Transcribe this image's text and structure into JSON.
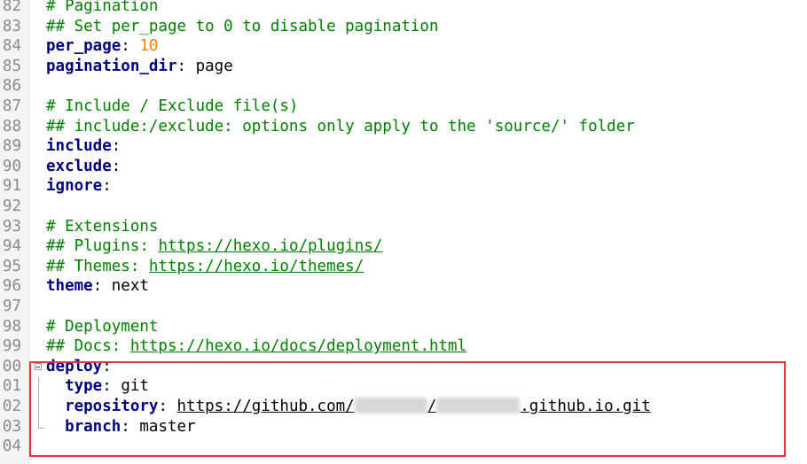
{
  "editor": {
    "lines": [
      {
        "num": "82",
        "parts": [
          {
            "t": "comment",
            "v": "# Pagination"
          }
        ]
      },
      {
        "num": "83",
        "parts": [
          {
            "t": "comment",
            "v": "## Set per_page to 0 to disable pagination"
          }
        ]
      },
      {
        "num": "84",
        "parts": [
          {
            "t": "key",
            "v": "per_page"
          },
          {
            "t": "sep",
            "v": ": "
          },
          {
            "t": "num",
            "v": "10"
          }
        ]
      },
      {
        "num": "85",
        "parts": [
          {
            "t": "key",
            "v": "pagination_dir"
          },
          {
            "t": "sep",
            "v": ": "
          },
          {
            "t": "val",
            "v": "page"
          }
        ]
      },
      {
        "num": "86",
        "parts": []
      },
      {
        "num": "87",
        "parts": [
          {
            "t": "comment",
            "v": "# Include / Exclude file(s)"
          }
        ]
      },
      {
        "num": "88",
        "parts": [
          {
            "t": "comment",
            "v": "## include:/exclude: options only apply to the 'source/' folder"
          }
        ]
      },
      {
        "num": "89",
        "parts": [
          {
            "t": "key",
            "v": "include"
          },
          {
            "t": "sep",
            "v": ":"
          }
        ]
      },
      {
        "num": "90",
        "parts": [
          {
            "t": "key",
            "v": "exclude"
          },
          {
            "t": "sep",
            "v": ":"
          }
        ]
      },
      {
        "num": "91",
        "parts": [
          {
            "t": "key",
            "v": "ignore"
          },
          {
            "t": "sep",
            "v": ":"
          }
        ]
      },
      {
        "num": "92",
        "parts": []
      },
      {
        "num": "93",
        "parts": [
          {
            "t": "comment",
            "v": "# Extensions"
          }
        ]
      },
      {
        "num": "94",
        "parts": [
          {
            "t": "comment",
            "v": "## Plugins: "
          },
          {
            "t": "link",
            "v": "https://hexo.io/plugins/"
          }
        ]
      },
      {
        "num": "95",
        "parts": [
          {
            "t": "comment",
            "v": "## Themes: "
          },
          {
            "t": "link",
            "v": "https://hexo.io/themes/"
          }
        ]
      },
      {
        "num": "96",
        "parts": [
          {
            "t": "key",
            "v": "theme"
          },
          {
            "t": "sep",
            "v": ": "
          },
          {
            "t": "val",
            "v": "next"
          }
        ]
      },
      {
        "num": "97",
        "parts": []
      },
      {
        "num": "98",
        "parts": [
          {
            "t": "comment",
            "v": "# Deployment"
          }
        ]
      },
      {
        "num": "99",
        "parts": [
          {
            "t": "comment",
            "v": "## Docs: "
          },
          {
            "t": "link",
            "v": "https://hexo.io/docs/deployment.html"
          }
        ]
      },
      {
        "num": "00",
        "fold": "open",
        "parts": [
          {
            "t": "key",
            "v": "deploy"
          },
          {
            "t": "sep",
            "v": ":"
          }
        ]
      },
      {
        "num": "01",
        "fold": "line",
        "parts": [
          {
            "t": "val",
            "v": "  "
          },
          {
            "t": "key",
            "v": "type"
          },
          {
            "t": "sep",
            "v": ": "
          },
          {
            "t": "val",
            "v": "git"
          }
        ]
      },
      {
        "num": "02",
        "fold": "line",
        "parts": [
          {
            "t": "val",
            "v": "  "
          },
          {
            "t": "key",
            "v": "repository"
          },
          {
            "t": "sep",
            "v": ": "
          },
          {
            "t": "url",
            "v": "https://github.com/"
          },
          {
            "t": "blur",
            "w": 82
          },
          {
            "t": "url",
            "v": "/"
          },
          {
            "t": "blur",
            "w": 94
          },
          {
            "t": "url",
            "v": ".github.io.git"
          }
        ]
      },
      {
        "num": "03",
        "fold": "end",
        "parts": [
          {
            "t": "val",
            "v": "  "
          },
          {
            "t": "key",
            "v": "branch"
          },
          {
            "t": "sep",
            "v": ": "
          },
          {
            "t": "val",
            "v": "master"
          }
        ]
      },
      {
        "num": "04",
        "parts": []
      }
    ]
  },
  "colors": {
    "comment": "#008000",
    "key": "#000080",
    "number": "#ff8000",
    "highlight_box": "#e5363a"
  }
}
